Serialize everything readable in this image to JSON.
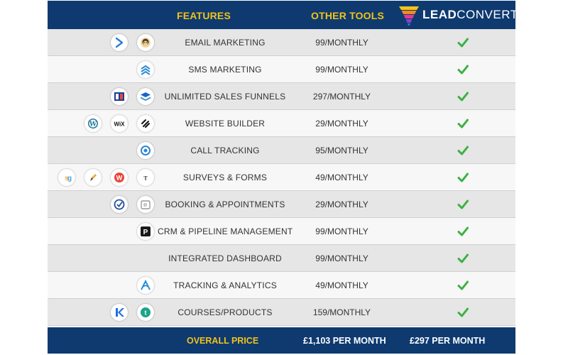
{
  "header": {
    "features_label": "FEATURES",
    "other_tools_label": "OTHER TOOLS",
    "logo_bold": "LEAD",
    "logo_light": "CONVERT"
  },
  "rows": [
    {
      "feature": "EMAIL MARKETING",
      "price": "99/MONTHLY",
      "icons": [
        "arrow-logo-icon",
        "mailchimp-icon"
      ]
    },
    {
      "feature": "SMS MARKETING",
      "price": "99/MONTHLY",
      "icons": [
        "stacked-chevrons-icon"
      ]
    },
    {
      "feature": "UNLIMITED SALES FUNNELS",
      "price": "297/MONTHLY",
      "icons": [
        "clickfunnels-icon",
        "layers-icon"
      ]
    },
    {
      "feature": "WEBSITE BUILDER",
      "price": "29/MONTHLY",
      "icons": [
        "wordpress-icon",
        "wix-icon",
        "squarespace-icon"
      ]
    },
    {
      "feature": "CALL TRACKING",
      "price": "95/MONTHLY",
      "icons": [
        "callrail-icon"
      ]
    },
    {
      "feature": "SURVEYS & FORMS",
      "price": "49/MONTHLY",
      "icons": [
        "surveygizmo-icon",
        "pen-icon",
        "wufoo-icon",
        "typeform-icon"
      ]
    },
    {
      "feature": "BOOKING & APPOINTMENTS",
      "price": "29/MONTHLY",
      "icons": [
        "check-circle-icon",
        "calendar-icon"
      ]
    },
    {
      "feature": "CRM & PIPELINE MANAGEMENT",
      "price": "99/MONTHLY",
      "icons": [
        "pipedrive-icon"
      ]
    },
    {
      "feature": "INTEGRATED DASHBOARD",
      "price": "99/MONTHLY",
      "icons": []
    },
    {
      "feature": "TRACKING & ANALYTICS",
      "price": "49/MONTHLY",
      "icons": [
        "analytics-icon"
      ]
    },
    {
      "feature": "COURSES/PRODUCTS",
      "price": "159/MONTHLY",
      "icons": [
        "kajabi-icon",
        "teachable-icon"
      ]
    }
  ],
  "footer": {
    "label": "OVERALL PRICE",
    "other_total": "£1,103 PER MONTH",
    "our_total": "£297 PER MONTH"
  },
  "colors": {
    "header_bg": "#0e3a70",
    "accent_yellow": "#f2c318",
    "check_green": "#3cb043"
  }
}
